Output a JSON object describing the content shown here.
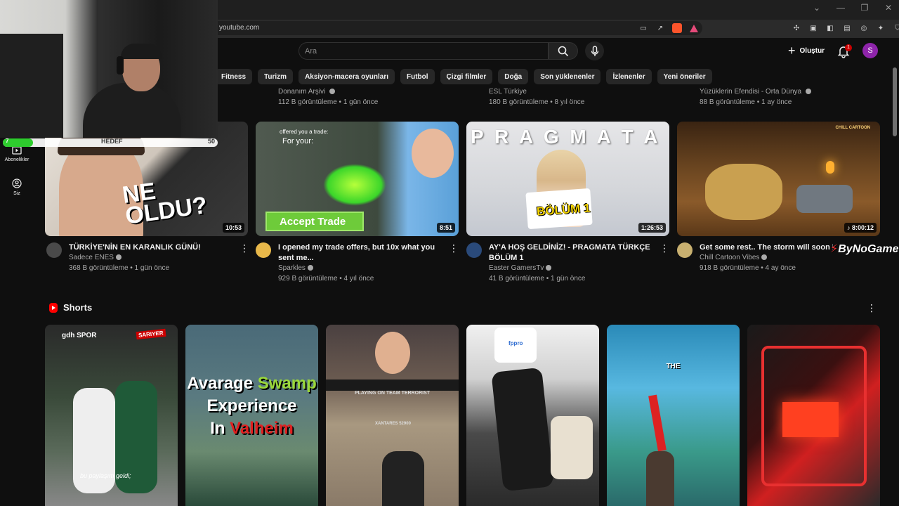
{
  "browser": {
    "url": "youtube.com",
    "window_controls": [
      "⌄",
      "—",
      "❐",
      "✕"
    ],
    "toolbar_right_icons": [
      "sidebar-icon",
      "wallet-icon",
      "profile-icon",
      "leo-icon",
      "vpn-icon",
      "menu-icon"
    ]
  },
  "header": {
    "search_placeholder": "Ara",
    "create_label": "Oluştur",
    "notification_count": "1",
    "avatar_letter": "S"
  },
  "chips": [
    "Fitness",
    "Turizm",
    "Aksiyon-macera oyunları",
    "Futbol",
    "Çizgi filmler",
    "Doğa",
    "Son yüklenenler",
    "İzlenenler",
    "Yeni öneriler"
  ],
  "prev_row": [
    {
      "channel": "Donanım Arşivi",
      "meta": "112 B görüntüleme • 1 gün önce"
    },
    {
      "channel": "ESL Türkiye",
      "meta": "180 B görüntüleme • 8 yıl önce"
    },
    {
      "channel": "Yüzüklerin Efendisi - Orta Dünya",
      "meta": "88 B görüntüleme • 1 ay önce"
    }
  ],
  "sidebar": [
    {
      "label": "Abonelikler"
    },
    {
      "label": "Siz"
    }
  ],
  "goal": {
    "start": "7",
    "label": "HEDEF",
    "end": "50",
    "progress": 0.14
  },
  "videos": [
    {
      "title": "TÜRKİYE'NİN EN KARANLIK GÜNÜ!",
      "channel": "Sadece ENES",
      "meta": "368 B görüntüleme • 1 gün önce",
      "duration": "10:53",
      "overlay": "NE\nOLDU?"
    },
    {
      "title": "I opened my trade offers, but 10x what you sent me...",
      "channel": "Sparkles",
      "meta": "929 B görüntüleme • 4 yıl önce",
      "duration": "8:51",
      "overlay_top": "offered you a trade:",
      "overlay_sub": "For your:",
      "overlay_btn": "Accept Trade"
    },
    {
      "title": "AY'A HOŞ GELDİNİZ! - PRAGMATA TÜRKÇE BÖLÜM 1",
      "channel": "Easter GamersTv",
      "meta": "41 B görüntüleme • 1 gün önce",
      "duration": "1:26:53",
      "overlay_top": "P R A G M A T A",
      "overlay_sign": "BÖLÜM 1"
    },
    {
      "title": "Get some rest.. The storm will soon be over",
      "channel": "Chill Cartoon Vibes",
      "meta": "918 B görüntüleme • 4 ay önce",
      "duration": "♪ 8:00:12",
      "overlay_corner": "CHILL CARTOON"
    }
  ],
  "watermark": "ByNoGame",
  "shorts": {
    "title": "Shorts",
    "items": [
      {
        "overlay": "gdh SPOR",
        "caption": "bu paylaşım geldi;",
        "badge": "SARIYER"
      },
      {
        "line1": "Avarage",
        "line1b": "Swamp",
        "line2": "Experience",
        "line3a": "In",
        "line3b": "Valheim"
      },
      {
        "overlay": "PLAYING ON TEAM TERRORIST",
        "score": "XANTARES 52900"
      },
      {
        "overlay": "fppro"
      },
      {
        "overlay": "THE"
      },
      {
        "overlay": ""
      }
    ]
  },
  "colors": {
    "background": "#0f0f0f",
    "chip_bg": "#272727",
    "accent_red": "#ff0000",
    "avatar_purple": "#8e24aa",
    "goal_green": "#2ecc2e"
  }
}
